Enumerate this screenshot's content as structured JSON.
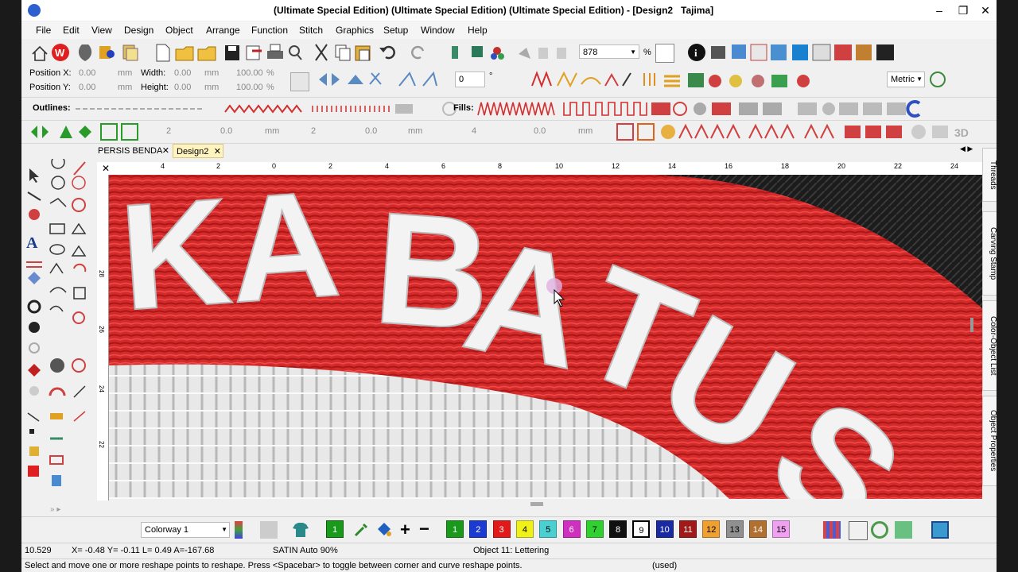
{
  "window": {
    "title": "(Ultimate Special Edition) (Ultimate Special Edition) (Ultimate Special Edition) - [Design2",
    "title_suffix": "Tajima]"
  },
  "menu": [
    "File",
    "Edit",
    "View",
    "Design",
    "Object",
    "Arrange",
    "Function",
    "Stitch",
    "Graphics",
    "Setup",
    "Window",
    "Help"
  ],
  "toolbar": {
    "zoom_value": "878",
    "zoom_unit": "%",
    "units_select": "Metric",
    "rotate_value": "0",
    "rotate_unit": "°"
  },
  "position": {
    "x_label": "Position X:",
    "x_value": "0.00",
    "x_unit": "mm",
    "y_label": "Position Y:",
    "y_value": "0.00",
    "y_unit": "mm",
    "width_label": "Width:",
    "width_value": "0.00",
    "width_unit": "mm",
    "width_pct": "100.00",
    "width_pct_unit": "%",
    "height_label": "Height:",
    "height_value": "0.00",
    "height_unit": "mm",
    "height_pct": "100.00",
    "height_pct_unit": "%"
  },
  "outline_fill_bar": {
    "outlines_label": "Outlines:",
    "fills_label": "Fills:"
  },
  "spacing_bar": {
    "v1": "2",
    "v2": "0.0",
    "u2": "mm",
    "v3": "2",
    "v4": "0.0",
    "u4": "mm",
    "v5": "4",
    "v6": "0.0",
    "u6": "mm"
  },
  "tabs": [
    {
      "label": "PERSIS BENDA"
    },
    {
      "label": "Design2"
    }
  ],
  "ruler_top": [
    "4",
    "2",
    "0",
    "2",
    "4",
    "6",
    "8",
    "10",
    "12",
    "14",
    "16",
    "18",
    "20",
    "22",
    "24"
  ],
  "ruler_left": [
    "28",
    "26",
    "24",
    "22"
  ],
  "dock_tabs": [
    "Threads",
    "Carving Stamp",
    "Color-Object List",
    "Object Properties"
  ],
  "colorbar": {
    "colorway": "Colorway 1",
    "current_color": "1",
    "swatches": [
      {
        "n": "1",
        "color": "#1a9a1a"
      },
      {
        "n": "2",
        "color": "#1a3ad0"
      },
      {
        "n": "3",
        "color": "#e01a1a"
      },
      {
        "n": "4",
        "color": "#f0f01a"
      },
      {
        "n": "5",
        "color": "#4ad0d0"
      },
      {
        "n": "6",
        "color": "#d030c0"
      },
      {
        "n": "7",
        "color": "#30d030"
      },
      {
        "n": "8",
        "color": "#101010"
      },
      {
        "n": "9",
        "color": "#ffffff"
      },
      {
        "n": "10",
        "color": "#1a2aa0"
      },
      {
        "n": "11",
        "color": "#a01a1a"
      },
      {
        "n": "12",
        "color": "#f0a030"
      },
      {
        "n": "13",
        "color": "#909090"
      },
      {
        "n": "14",
        "color": "#b07030"
      },
      {
        "n": "15",
        "color": "#f0a0f0"
      }
    ]
  },
  "status": {
    "zoom": "10.529",
    "coords": "X= -0.48 Y= -0.11 L= 0.49 A=-167.68",
    "stitch_type": "SATIN Auto 90%",
    "object": "Object 11: Lettering"
  },
  "help": {
    "text": "Select and move one or more reshape points to reshape. Press <Spacebar> to toggle between corner and curve reshape points.",
    "used": "(used)"
  },
  "design": {
    "letters": [
      "KA",
      "B",
      "A",
      "T",
      "U",
      "S"
    ]
  }
}
